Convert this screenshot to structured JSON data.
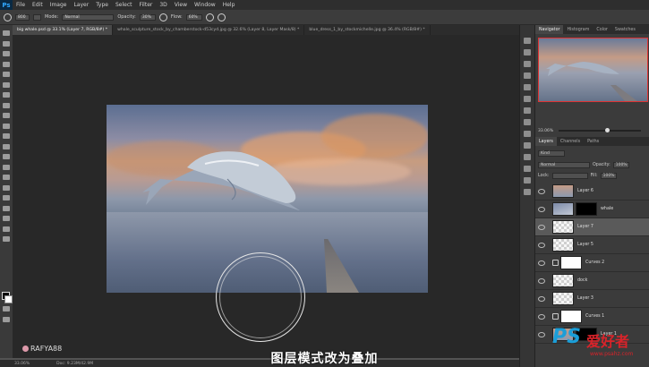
{
  "app": {
    "logo": "Ps"
  },
  "menu": [
    "File",
    "Edit",
    "Image",
    "Layer",
    "Type",
    "Select",
    "Filter",
    "3D",
    "View",
    "Window",
    "Help"
  ],
  "options": {
    "brush_size": "800",
    "mode_label": "Mode:",
    "mode_value": "Normal",
    "opacity_label": "Opacity:",
    "opacity_value": "30%",
    "flow_label": "Flow:",
    "flow_value": "60%"
  },
  "tabs": [
    {
      "label": "big whale.psd @ 33.1% (Layer 7, RGB/8#) *",
      "active": true
    },
    {
      "label": "whale_sculpture_stock_by_chamberstock-d53cyd.jpg @ 32.6% (Layer 8, Layer Mask/8) *",
      "active": false
    },
    {
      "label": "blue_dress_1_by_stockmichelle.jpg @ 36.4% (RGB/8#) *",
      "active": false
    }
  ],
  "navigator": {
    "tabs": [
      "Navigator",
      "Histogram",
      "Color",
      "Swatches"
    ],
    "zoom": "33.06%"
  },
  "layers_panel": {
    "tabs": [
      "Layers",
      "Channels",
      "Paths"
    ],
    "kind_label": "Kind",
    "blend_mode": "Normal",
    "opacity_label": "Opacity:",
    "opacity_value": "100%",
    "lock_label": "Lock:",
    "fill_label": "Fill:",
    "fill_value": "100%",
    "layers": [
      {
        "name": "Layer 6",
        "thumb": "sky",
        "mask": null,
        "clip": true,
        "adj": false
      },
      {
        "name": "whale",
        "thumb": "whale",
        "mask": "black",
        "clip": false,
        "adj": false
      },
      {
        "name": "Layer 7",
        "thumb": "empty",
        "mask": null,
        "clip": false,
        "adj": false,
        "selected": true
      },
      {
        "name": "Layer 5",
        "thumb": "empty",
        "mask": null,
        "clip": false,
        "adj": false
      },
      {
        "name": "Curves 2",
        "thumb": "curve",
        "mask": "white",
        "clip": true,
        "adj": true
      },
      {
        "name": "dock",
        "thumb": "empty",
        "mask": null,
        "clip": true,
        "adj": false
      },
      {
        "name": "Layer 3",
        "thumb": "empty",
        "mask": null,
        "clip": false,
        "adj": false
      },
      {
        "name": "Curves 1",
        "thumb": "curve",
        "mask": "white",
        "clip": true,
        "adj": true
      },
      {
        "name": "Layer 1",
        "thumb": "sky",
        "mask": "black",
        "clip": false,
        "adj": false
      }
    ]
  },
  "status": {
    "zoom": "33.06%",
    "doc": "Doc: 9.23M/42.9M"
  },
  "watermark": "RAFYA88",
  "caption": "图层模式改为叠加",
  "site_logo": {
    "ps": "PS",
    "cn": "爱好者",
    "url": "www.psahz.com"
  }
}
